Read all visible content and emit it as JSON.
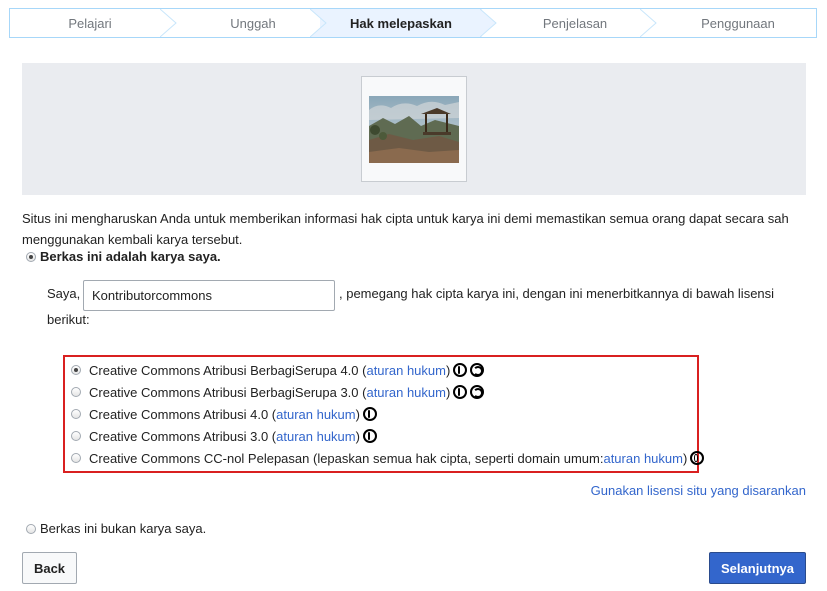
{
  "steps": [
    "Pelajari",
    "Unggah",
    "Hak melepaskan",
    "Penjelasan",
    "Penggunaan"
  ],
  "active_step": 2,
  "intro_text": "Situs ini mengharuskan Anda untuk memberikan informasi hak cipta untuk karya ini demi memastikan semua orang dapat secara sah menggunakan kembali karya tersebut.",
  "own_work_label": "Berkas ini adalah karya saya.",
  "author": {
    "prefix": "Saya,",
    "value": "Kontributorcommons",
    "suffix": ", pemegang hak cipta karya ini, dengan ini menerbitkannya di bawah lisensi",
    "suffix2": "berikut:"
  },
  "licenses": [
    {
      "name": "Creative Commons Atribusi BerbagiSerupa 4.0 (",
      "link": "aturan hukum",
      "close": ")",
      "icons": [
        "cc-by-icon",
        "cc-sa-icon"
      ],
      "selected": true
    },
    {
      "name": "Creative Commons Atribusi BerbagiSerupa 3.0 (",
      "link": "aturan hukum",
      "close": ")",
      "icons": [
        "cc-by-icon",
        "cc-sa-icon"
      ],
      "selected": false
    },
    {
      "name": "Creative Commons Atribusi 4.0 (",
      "link": "aturan hukum",
      "close": ")",
      "icons": [
        "cc-by-icon"
      ],
      "selected": false
    },
    {
      "name": "Creative Commons Atribusi 3.0 (",
      "link": "aturan hukum",
      "close": ")",
      "icons": [
        "cc-by-icon"
      ],
      "selected": false
    },
    {
      "name": "Creative Commons CC-nol Pelepasan (lepaskan semua hak cipta, seperti domain umum: ",
      "link": "aturan hukum",
      "close": ")",
      "icons": [
        "cc-zero-icon"
      ],
      "selected": false
    }
  ],
  "suggested_link": "Gunakan lisensi situ yang disarankan",
  "not_own_work_label": "Berkas ini bukan karya saya.",
  "buttons": {
    "back": "Back",
    "next": "Selanjutnya"
  },
  "colors": {
    "link": "#3366cc",
    "highlight_border": "#d92020",
    "primary_button": "#3366cc"
  }
}
